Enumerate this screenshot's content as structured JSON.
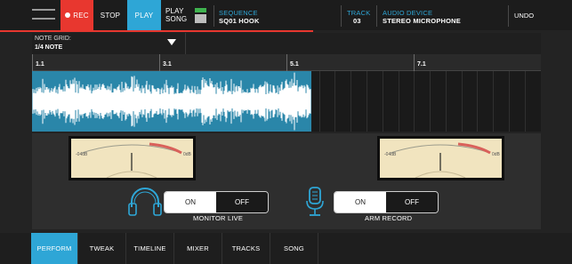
{
  "toolbar": {
    "rec_label": "REC",
    "stop_label": "STOP",
    "play_label": "PLAY",
    "play_song_line1": "PLAY",
    "play_song_line2": "SONG",
    "sequence_label": "SEQUENCE",
    "sequence_value": "SQ01 HOOK",
    "track_label": "TRACK",
    "track_value": "03",
    "audio_device_label": "AUDIO DEVICE",
    "audio_device_value": "STEREO MICROPHONE",
    "undo_label": "UNDO"
  },
  "note_grid": {
    "label": "NOTE GRID:",
    "value": "1/4 NOTE"
  },
  "ruler": {
    "marks": [
      "1.1",
      "3.1",
      "5.1",
      "7.1"
    ]
  },
  "meters": {
    "left": {
      "low_label": "-04dB",
      "high_label": "0dB"
    },
    "right": {
      "low_label": "-04dB",
      "high_label": "0dB"
    }
  },
  "monitor": {
    "on_label": "ON",
    "off_label": "OFF",
    "caption": "MONITOR LIVE"
  },
  "arm": {
    "on_label": "ON",
    "off_label": "OFF",
    "caption": "ARM RECORD"
  },
  "tabs": [
    {
      "label": "PERFORM",
      "active": true
    },
    {
      "label": "TWEAK",
      "active": false
    },
    {
      "label": "TIMELINE",
      "active": false
    },
    {
      "label": "MIXER",
      "active": false
    },
    {
      "label": "TRACKS",
      "active": false
    },
    {
      "label": "SONG",
      "active": false
    }
  ],
  "colors": {
    "accent": "#2ea6d6",
    "record": "#e8372f",
    "waveform_bg": "#2a86a9",
    "meter_face": "#f1e4bf"
  }
}
